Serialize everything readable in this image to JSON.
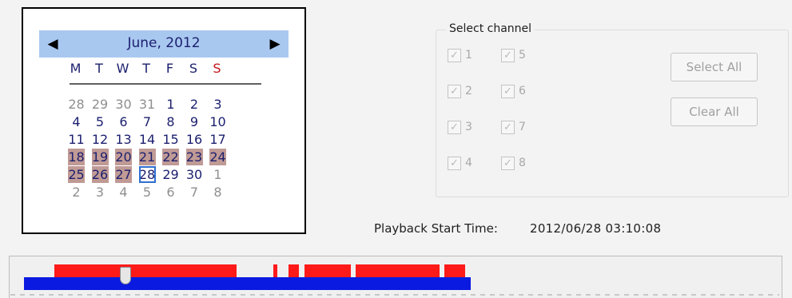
{
  "calendar": {
    "month_title": "June, 2012",
    "prev_symbol": "◀",
    "next_symbol": "▶",
    "weekday_headers": [
      "M",
      "T",
      "W",
      "T",
      "F",
      "S",
      "S"
    ],
    "weeks": [
      [
        {
          "d": "28",
          "s": "other"
        },
        {
          "d": "29",
          "s": "other"
        },
        {
          "d": "30",
          "s": "other"
        },
        {
          "d": "31",
          "s": "other"
        },
        {
          "d": "1",
          "s": ""
        },
        {
          "d": "2",
          "s": ""
        },
        {
          "d": "3",
          "s": ""
        }
      ],
      [
        {
          "d": "4",
          "s": ""
        },
        {
          "d": "5",
          "s": ""
        },
        {
          "d": "6",
          "s": ""
        },
        {
          "d": "7",
          "s": ""
        },
        {
          "d": "8",
          "s": ""
        },
        {
          "d": "9",
          "s": ""
        },
        {
          "d": "10",
          "s": ""
        }
      ],
      [
        {
          "d": "11",
          "s": ""
        },
        {
          "d": "12",
          "s": ""
        },
        {
          "d": "13",
          "s": ""
        },
        {
          "d": "14",
          "s": ""
        },
        {
          "d": "15",
          "s": ""
        },
        {
          "d": "16",
          "s": ""
        },
        {
          "d": "17",
          "s": ""
        }
      ],
      [
        {
          "d": "18",
          "s": "rec"
        },
        {
          "d": "19",
          "s": "rec"
        },
        {
          "d": "20",
          "s": "rec"
        },
        {
          "d": "21",
          "s": "rec"
        },
        {
          "d": "22",
          "s": "rec"
        },
        {
          "d": "23",
          "s": "rec"
        },
        {
          "d": "24",
          "s": "rec"
        }
      ],
      [
        {
          "d": "25",
          "s": "rec"
        },
        {
          "d": "26",
          "s": "rec"
        },
        {
          "d": "27",
          "s": "rec"
        },
        {
          "d": "28",
          "s": "today"
        },
        {
          "d": "29",
          "s": ""
        },
        {
          "d": "30",
          "s": ""
        },
        {
          "d": "1",
          "s": "other"
        }
      ],
      [
        {
          "d": "2",
          "s": "other"
        },
        {
          "d": "3",
          "s": "other"
        },
        {
          "d": "4",
          "s": "other"
        },
        {
          "d": "5",
          "s": "other"
        },
        {
          "d": "6",
          "s": "other"
        },
        {
          "d": "7",
          "s": "other"
        },
        {
          "d": "8",
          "s": "other"
        }
      ]
    ],
    "colors": {
      "header_bg": "#a9c8f0",
      "recorded_day": "#c09a95",
      "selected_border": "#2f6fd1",
      "sunday_header": "#c0141a"
    }
  },
  "select_channel": {
    "legend": "Select channel",
    "checkbox_mark": "✓",
    "channels": [
      {
        "label": "1",
        "checked": true
      },
      {
        "label": "2",
        "checked": true
      },
      {
        "label": "3",
        "checked": true
      },
      {
        "label": "4",
        "checked": true
      },
      {
        "label": "5",
        "checked": true
      },
      {
        "label": "6",
        "checked": true
      },
      {
        "label": "7",
        "checked": true
      },
      {
        "label": "8",
        "checked": true
      }
    ],
    "select_all_label": "Select All",
    "clear_all_label": "Clear All"
  },
  "playback": {
    "start_time_label": "Playback Start Time:",
    "start_time_value": "2012/06/28 03:10:08"
  },
  "timeline": {
    "colors": {
      "recording": "#ff1a1a",
      "track": "#0b1ae0"
    }
  }
}
